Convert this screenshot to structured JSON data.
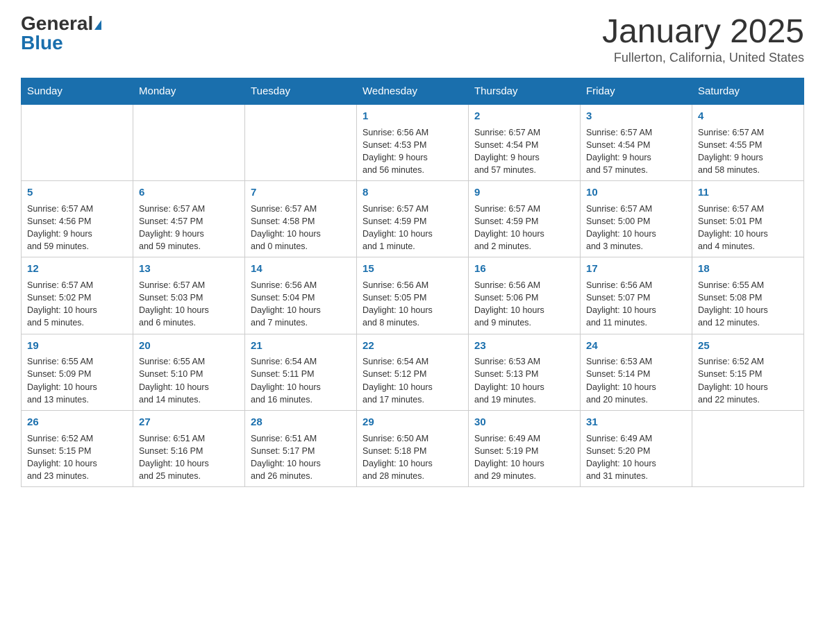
{
  "header": {
    "logo_general": "General",
    "logo_blue": "Blue",
    "month_title": "January 2025",
    "location": "Fullerton, California, United States"
  },
  "weekdays": [
    "Sunday",
    "Monday",
    "Tuesday",
    "Wednesday",
    "Thursday",
    "Friday",
    "Saturday"
  ],
  "weeks": [
    [
      {
        "day": "",
        "info": ""
      },
      {
        "day": "",
        "info": ""
      },
      {
        "day": "",
        "info": ""
      },
      {
        "day": "1",
        "info": "Sunrise: 6:56 AM\nSunset: 4:53 PM\nDaylight: 9 hours\nand 56 minutes."
      },
      {
        "day": "2",
        "info": "Sunrise: 6:57 AM\nSunset: 4:54 PM\nDaylight: 9 hours\nand 57 minutes."
      },
      {
        "day": "3",
        "info": "Sunrise: 6:57 AM\nSunset: 4:54 PM\nDaylight: 9 hours\nand 57 minutes."
      },
      {
        "day": "4",
        "info": "Sunrise: 6:57 AM\nSunset: 4:55 PM\nDaylight: 9 hours\nand 58 minutes."
      }
    ],
    [
      {
        "day": "5",
        "info": "Sunrise: 6:57 AM\nSunset: 4:56 PM\nDaylight: 9 hours\nand 59 minutes."
      },
      {
        "day": "6",
        "info": "Sunrise: 6:57 AM\nSunset: 4:57 PM\nDaylight: 9 hours\nand 59 minutes."
      },
      {
        "day": "7",
        "info": "Sunrise: 6:57 AM\nSunset: 4:58 PM\nDaylight: 10 hours\nand 0 minutes."
      },
      {
        "day": "8",
        "info": "Sunrise: 6:57 AM\nSunset: 4:59 PM\nDaylight: 10 hours\nand 1 minute."
      },
      {
        "day": "9",
        "info": "Sunrise: 6:57 AM\nSunset: 4:59 PM\nDaylight: 10 hours\nand 2 minutes."
      },
      {
        "day": "10",
        "info": "Sunrise: 6:57 AM\nSunset: 5:00 PM\nDaylight: 10 hours\nand 3 minutes."
      },
      {
        "day": "11",
        "info": "Sunrise: 6:57 AM\nSunset: 5:01 PM\nDaylight: 10 hours\nand 4 minutes."
      }
    ],
    [
      {
        "day": "12",
        "info": "Sunrise: 6:57 AM\nSunset: 5:02 PM\nDaylight: 10 hours\nand 5 minutes."
      },
      {
        "day": "13",
        "info": "Sunrise: 6:57 AM\nSunset: 5:03 PM\nDaylight: 10 hours\nand 6 minutes."
      },
      {
        "day": "14",
        "info": "Sunrise: 6:56 AM\nSunset: 5:04 PM\nDaylight: 10 hours\nand 7 minutes."
      },
      {
        "day": "15",
        "info": "Sunrise: 6:56 AM\nSunset: 5:05 PM\nDaylight: 10 hours\nand 8 minutes."
      },
      {
        "day": "16",
        "info": "Sunrise: 6:56 AM\nSunset: 5:06 PM\nDaylight: 10 hours\nand 9 minutes."
      },
      {
        "day": "17",
        "info": "Sunrise: 6:56 AM\nSunset: 5:07 PM\nDaylight: 10 hours\nand 11 minutes."
      },
      {
        "day": "18",
        "info": "Sunrise: 6:55 AM\nSunset: 5:08 PM\nDaylight: 10 hours\nand 12 minutes."
      }
    ],
    [
      {
        "day": "19",
        "info": "Sunrise: 6:55 AM\nSunset: 5:09 PM\nDaylight: 10 hours\nand 13 minutes."
      },
      {
        "day": "20",
        "info": "Sunrise: 6:55 AM\nSunset: 5:10 PM\nDaylight: 10 hours\nand 14 minutes."
      },
      {
        "day": "21",
        "info": "Sunrise: 6:54 AM\nSunset: 5:11 PM\nDaylight: 10 hours\nand 16 minutes."
      },
      {
        "day": "22",
        "info": "Sunrise: 6:54 AM\nSunset: 5:12 PM\nDaylight: 10 hours\nand 17 minutes."
      },
      {
        "day": "23",
        "info": "Sunrise: 6:53 AM\nSunset: 5:13 PM\nDaylight: 10 hours\nand 19 minutes."
      },
      {
        "day": "24",
        "info": "Sunrise: 6:53 AM\nSunset: 5:14 PM\nDaylight: 10 hours\nand 20 minutes."
      },
      {
        "day": "25",
        "info": "Sunrise: 6:52 AM\nSunset: 5:15 PM\nDaylight: 10 hours\nand 22 minutes."
      }
    ],
    [
      {
        "day": "26",
        "info": "Sunrise: 6:52 AM\nSunset: 5:15 PM\nDaylight: 10 hours\nand 23 minutes."
      },
      {
        "day": "27",
        "info": "Sunrise: 6:51 AM\nSunset: 5:16 PM\nDaylight: 10 hours\nand 25 minutes."
      },
      {
        "day": "28",
        "info": "Sunrise: 6:51 AM\nSunset: 5:17 PM\nDaylight: 10 hours\nand 26 minutes."
      },
      {
        "day": "29",
        "info": "Sunrise: 6:50 AM\nSunset: 5:18 PM\nDaylight: 10 hours\nand 28 minutes."
      },
      {
        "day": "30",
        "info": "Sunrise: 6:49 AM\nSunset: 5:19 PM\nDaylight: 10 hours\nand 29 minutes."
      },
      {
        "day": "31",
        "info": "Sunrise: 6:49 AM\nSunset: 5:20 PM\nDaylight: 10 hours\nand 31 minutes."
      },
      {
        "day": "",
        "info": ""
      }
    ]
  ]
}
